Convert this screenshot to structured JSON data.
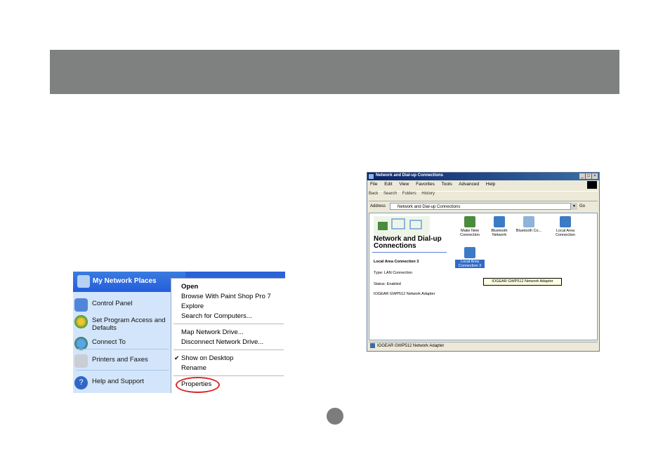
{
  "start_menu": {
    "title": "My Network Places",
    "items": [
      {
        "label": "Control Panel",
        "icon": "control-panel-icon"
      },
      {
        "label": "Set Program Access and Defaults",
        "icon": "program-access-icon"
      },
      {
        "label": "Connect To",
        "icon": "globe-icon"
      },
      {
        "label": "Printers and Faxes",
        "icon": "printer-icon"
      },
      {
        "label": "Help and Support",
        "icon": "help-icon"
      }
    ],
    "context_menu": {
      "items": [
        "Open",
        "Browse With Paint Shop Pro 7",
        "Explore",
        "Search for Computers...",
        "Map Network Drive...",
        "Disconnect Network Drive...",
        "Show on Desktop",
        "Rename",
        "Properties"
      ],
      "checked": "Show on Desktop",
      "highlight_color": "#d9262a"
    }
  },
  "explorer": {
    "title": "Network and Dial-up Connections",
    "menu": [
      "File",
      "Edit",
      "View",
      "Favorites",
      "Tools",
      "Advanced",
      "Help"
    ],
    "toolbar": [
      "Back",
      "Search",
      "Folders",
      "History"
    ],
    "address_label": "Address",
    "address_value": "Network and Dial-up Connections",
    "go_label": "Go",
    "panel_title": "Network and Dial-up Connections",
    "details": {
      "name": "Local Area Connection 3",
      "type": "Type: LAN Connection",
      "status": "Status: Enabled",
      "adapter": "IOGEAR GWP512 Network Adapter"
    },
    "icons": [
      {
        "label": "Make New Connection"
      },
      {
        "label": "Bluetooth Network"
      },
      {
        "label": "Bluetooth Co..."
      },
      {
        "label": "Local Area Connection"
      },
      {
        "label": "Local Area Connection 3"
      }
    ],
    "tooltip": "IOGEAR GWP512 Network Adapter",
    "status_bar": "IOGEAR GWP512 Network Adapter"
  },
  "colors": {
    "header_band": "#7f8080",
    "page_dot": "#7c7c7c"
  }
}
